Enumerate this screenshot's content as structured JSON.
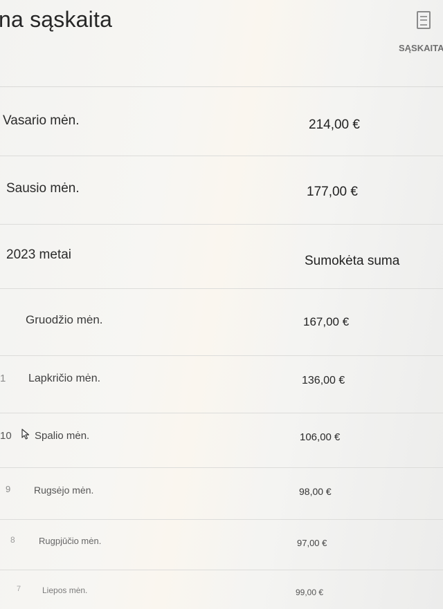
{
  "header": {
    "title": "na sąskaita",
    "invoice_link": "SĄSKAITA",
    "invoice_icon": "document-icon"
  },
  "rows": [
    {
      "index": "",
      "label": "Vasario mėn.",
      "amount": "214,00 €"
    },
    {
      "index": "",
      "label": "Sausio mėn.",
      "amount": "177,00 €"
    },
    {
      "index": "",
      "label": "2023 metai",
      "amount": "Sumokėta suma"
    },
    {
      "index": "",
      "label": "Gruodžio mėn.",
      "amount": "167,00 €"
    },
    {
      "index": "1",
      "label": "Lapkričio mėn.",
      "amount": "136,00 €"
    },
    {
      "index": "10",
      "label": "Spalio mėn.",
      "amount": "106,00 €"
    },
    {
      "index": "9",
      "label": "Rugsėjo mėn.",
      "amount": "98,00 €"
    },
    {
      "index": "8",
      "label": "Rugpjūčio mėn.",
      "amount": "97,00 €"
    },
    {
      "index": "7",
      "label": "Liepos mėn.",
      "amount": "99,00 €"
    }
  ],
  "cursor": "pointer-cursor-icon"
}
